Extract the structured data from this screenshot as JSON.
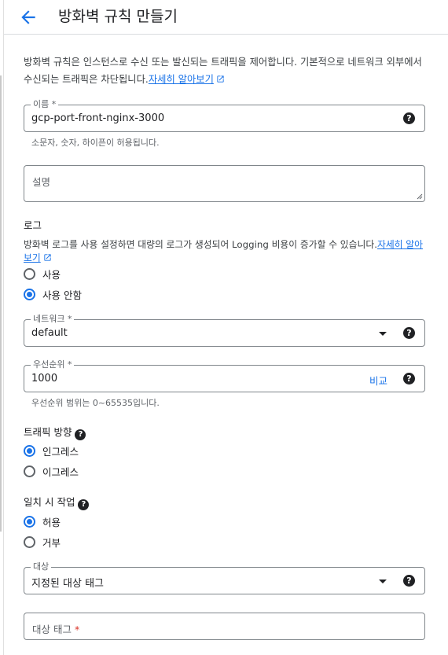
{
  "header": {
    "title": "방화벽 규칙 만들기"
  },
  "intro": {
    "text": "방화벽 규칙은 인스턴스로 수신 또는 발신되는 트래픽을 제어합니다. 기본적으로 네트워크 외부에서 수신되는 트래픽은 차단됩니다.",
    "link": "자세히 알아보기"
  },
  "name_field": {
    "label": "이름 *",
    "value": "gcp-port-front-nginx-3000",
    "hint": "소문자, 숫자, 하이픈이 허용됩니다."
  },
  "description_field": {
    "placeholder": "설명"
  },
  "logs": {
    "heading": "로그",
    "text": "방화벽 로그를 사용 설정하면 대량의 로그가 생성되어 Logging 비용이 증가할 수 있습니다.",
    "link": "자세히 알아보기",
    "options": [
      "사용",
      "사용 안함"
    ],
    "selected": "사용 안함"
  },
  "network_field": {
    "label": "네트워크 *",
    "value": "default"
  },
  "priority_field": {
    "label": "우선순위 *",
    "value": "1000",
    "compare": "비교",
    "hint": "우선순위 범위는 0~65535입니다."
  },
  "direction": {
    "heading": "트래픽 방향",
    "options": [
      "인그레스",
      "이그레스"
    ],
    "selected": "인그레스"
  },
  "action": {
    "heading": "일치 시 작업",
    "options": [
      "허용",
      "거부"
    ],
    "selected": "허용"
  },
  "target_field": {
    "label": "대상",
    "value": "지정된 대상 태그"
  },
  "target_tags_field": {
    "placeholder": "대상 태그",
    "required_mark": "*"
  },
  "icons": {
    "help": "?",
    "help_icon": "help-circle-icon",
    "back_icon": "arrow-back-icon",
    "external_icon": "open-in-new-icon"
  },
  "colors": {
    "accent": "#1a73e8",
    "text": "#202124",
    "secondary": "#5f6368",
    "border": "#80868b",
    "required": "#d93025"
  }
}
